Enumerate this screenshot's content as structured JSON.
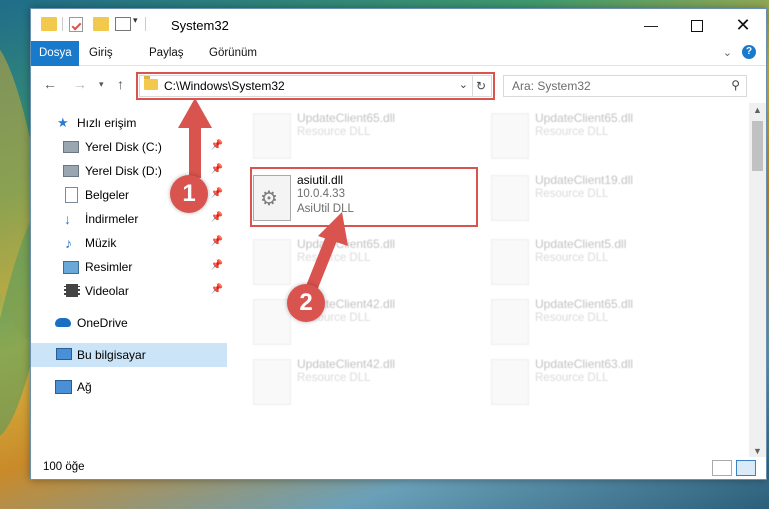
{
  "window": {
    "title": "System32"
  },
  "ribbon": {
    "tabs": [
      "Dosya",
      "Giriş",
      "Paylaş",
      "Görünüm"
    ]
  },
  "address": {
    "path": "C:\\Windows\\System32"
  },
  "search": {
    "placeholder": "Ara: System32"
  },
  "sidebar": {
    "items": [
      {
        "label": "Hızlı erişim"
      },
      {
        "label": "Yerel Disk (C:)"
      },
      {
        "label": "Yerel Disk (D:)"
      },
      {
        "label": "Belgeler"
      },
      {
        "label": "İndirmeler"
      },
      {
        "label": "Müzik"
      },
      {
        "label": "Resimler"
      },
      {
        "label": "Videolar"
      },
      {
        "label": "OneDrive"
      },
      {
        "label": "Bu bilgisayar"
      },
      {
        "label": "Ağ"
      }
    ]
  },
  "files": [
    {
      "name": "UpdateClient65.dll",
      "type": "Resource DLL"
    },
    {
      "name": "UpdateClient65.dll",
      "type": "Resource DLL"
    },
    {
      "name": "asiutil.dll",
      "version": "10.0.4.33",
      "type": "AsiUtil DLL"
    },
    {
      "name": "UpdateClient19.dll",
      "type": "Resource DLL"
    },
    {
      "name": "UpdateClient65.dll",
      "type": "Resource DLL"
    },
    {
      "name": "UpdateClient5.dll",
      "type": "Resource DLL"
    },
    {
      "name": "UpdateClient42.dll",
      "type": "Resource DLL"
    },
    {
      "name": "UpdateClient65.dll",
      "type": "Resource DLL"
    },
    {
      "name": "UpdateClient42.dll",
      "type": "Resource DLL"
    },
    {
      "name": "UpdateClient63.dll",
      "type": "Resource DLL"
    }
  ],
  "status": {
    "count": "100 öğe"
  },
  "badges": [
    "1",
    "2"
  ],
  "colors": {
    "accent": "#1979ca",
    "highlight": "#d9534f"
  }
}
